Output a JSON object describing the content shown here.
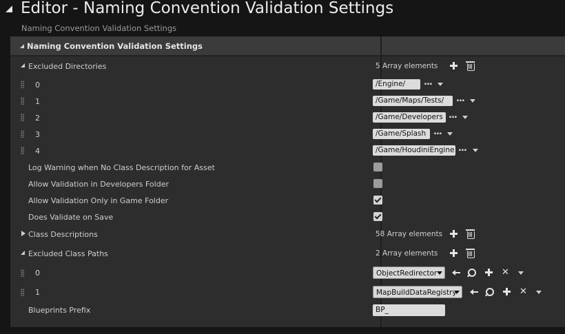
{
  "window": {
    "title": "Editor - Naming Convention Validation Settings",
    "subtitle": "Naming Convention Validation Settings"
  },
  "section": {
    "title": "Naming Convention Validation Settings"
  },
  "excluded_directories": {
    "label": "Excluded Directories",
    "count": "5 Array elements",
    "items": [
      {
        "index": "0",
        "value": "/Engine/"
      },
      {
        "index": "1",
        "value": "/Game/Maps/Tests/"
      },
      {
        "index": "2",
        "value": "/Game/Developers"
      },
      {
        "index": "3",
        "value": "/Game/Splash"
      },
      {
        "index": "4",
        "value": "/Game/HoudiniEngine"
      }
    ]
  },
  "options": [
    {
      "label": "Log Warning when No Class Description for Asset",
      "checked": false
    },
    {
      "label": "Allow Validation in Developers Folder",
      "checked": false
    },
    {
      "label": "Allow Validation Only in Game Folder",
      "checked": true
    },
    {
      "label": "Does Validate on Save",
      "checked": true
    }
  ],
  "class_descriptions": {
    "label": "Class Descriptions",
    "count": "58 Array elements"
  },
  "excluded_class_paths": {
    "label": "Excluded Class Paths",
    "count": "2 Array elements",
    "items": [
      {
        "index": "0",
        "value": "ObjectRedirector"
      },
      {
        "index": "1",
        "value": "MapBuildDataRegistry"
      }
    ]
  },
  "blueprints_prefix": {
    "label": "Blueprints Prefix",
    "value": "BP_"
  },
  "ellipsis": "...",
  "icons": {
    "collapse": "collapse-arrow-icon",
    "add": "plus-icon",
    "remove": "trash-icon",
    "use_selected": "left-arrow-icon",
    "browse": "magnifier-icon",
    "clear": "x-icon",
    "more": "chevron-down-icon",
    "drag": "grip-icon"
  },
  "colors": {
    "background": "#151515",
    "panel": "#2d2d2d",
    "header": "#3b3b3b",
    "field": "#dcdcdc"
  }
}
